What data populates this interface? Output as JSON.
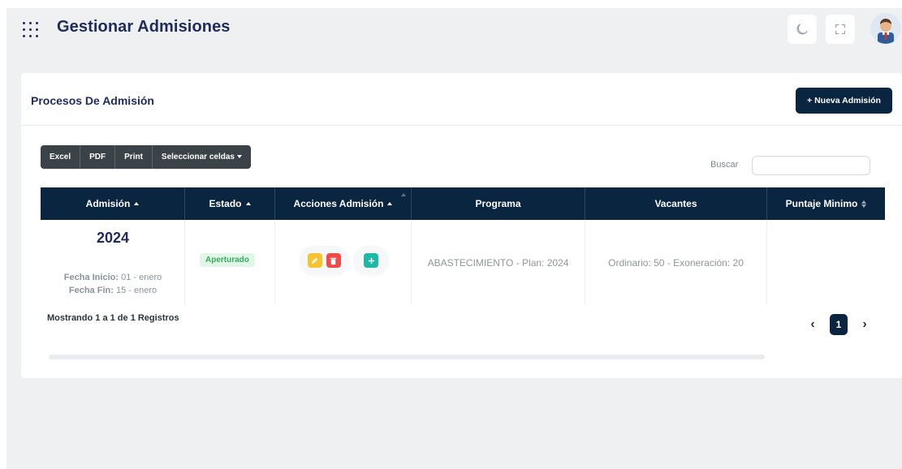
{
  "header": {
    "title": "Gestionar Admisiones",
    "icons": [
      "apps-grid-icon",
      "moon-icon",
      "fullscreen-icon",
      "avatar"
    ]
  },
  "card": {
    "title": "Procesos De Admisión",
    "new_button": "+ Nueva Admisión"
  },
  "toolbar": {
    "excel": "Excel",
    "pdf": "PDF",
    "print": "Print",
    "select_cells": "Seleccionar celdas"
  },
  "search": {
    "label": "Buscar",
    "value": ""
  },
  "table": {
    "headers": {
      "admision": "Admisión",
      "estado": "Estado",
      "acciones": "Acciones Admisión",
      "programa": "Programa",
      "vacantes": "Vacantes",
      "puntaje": "Puntaje Minimo"
    },
    "rows": [
      {
        "year": "2024",
        "fecha_inicio_label": "Fecha Inicio:",
        "fecha_inicio": "01 - enero",
        "fecha_fin_label": "Fecha Fin:",
        "fecha_fin": "15 - enero",
        "estado": "Aperturado",
        "programa": "ABASTECIMIENTO - Plan: 2024",
        "vacantes": "Ordinario: 50 - Exoneración: 20",
        "puntaje": ""
      }
    ]
  },
  "footer": {
    "info": "Mostrando 1 a 1 de 1 Registros",
    "current_page": "1",
    "prev": "‹",
    "next": "›"
  },
  "colors": {
    "primary": "#0a2540",
    "title": "#1f2b5b",
    "edit": "#f7c32e",
    "delete": "#ef4b4b",
    "add": "#1fb8a5",
    "badge_bg": "#e3f7e9",
    "badge_text": "#2fae5c"
  }
}
